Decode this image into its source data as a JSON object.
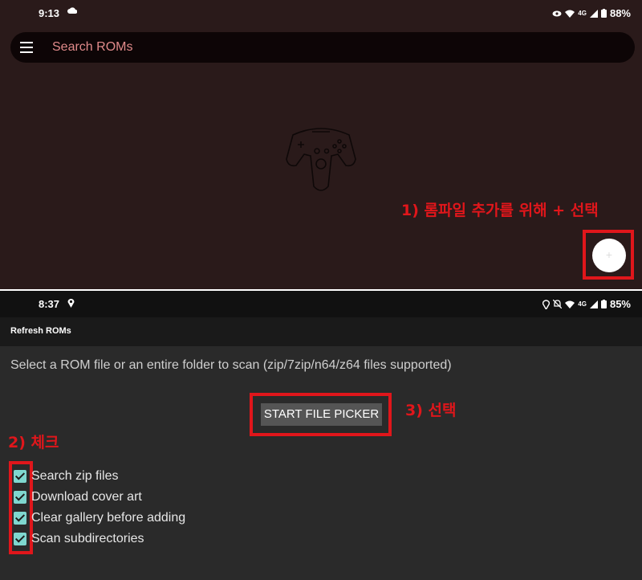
{
  "top_screen": {
    "status_bar": {
      "time": "9:13",
      "battery": "88%",
      "network": "4G"
    },
    "search": {
      "placeholder": "Search ROMs"
    },
    "annotation": "1) 롬파일 추가를 위해 + 선택",
    "fab": {
      "symbol": "+"
    }
  },
  "bottom_screen": {
    "status_bar": {
      "time": "8:37",
      "battery": "85%",
      "network": "4G"
    },
    "app_title": "Refresh ROMs",
    "description": "Select a ROM file or an entire folder to scan (zip/7zip/n64/z64 files supported)",
    "picker_button": "START FILE PICKER",
    "annotations": {
      "check": "2) 체크",
      "select": "3) 선택"
    },
    "options": [
      {
        "label": "Search zip files",
        "checked": true
      },
      {
        "label": "Download cover art",
        "checked": true
      },
      {
        "label": "Clear gallery before adding",
        "checked": true
      },
      {
        "label": "Scan subdirectories",
        "checked": true
      }
    ]
  },
  "colors": {
    "annotation": "#e0161b",
    "checkbox": "#7fd7cf",
    "search_placeholder": "#e08a8a"
  }
}
